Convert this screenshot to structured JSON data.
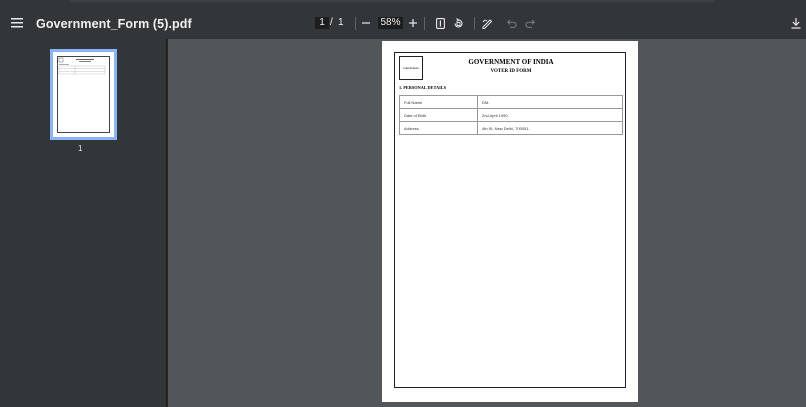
{
  "toolbar": {
    "title": "Government_Form (5).pdf",
    "page_current": "1",
    "page_separator": "/",
    "page_total": "1",
    "zoom": "58%"
  },
  "sidebar": {
    "thumbnail_label": "1"
  },
  "document": {
    "photo_label": "Candidate",
    "title": "GOVERNMENT OF INDIA",
    "subtitle": "VOTER ID FORM",
    "section_title": "1. PERSONAL DETAILS",
    "rows": [
      {
        "label": "Full Name",
        "value": "DM."
      },
      {
        "label": "Date of Birth",
        "value": "2nd April 1990."
      },
      {
        "label": "Address",
        "value": "4th St. New Delhi, 700051."
      }
    ]
  },
  "colors": {
    "toolbar_bg": "#323639",
    "viewer_bg": "#525659",
    "thumb_highlight": "#8ab4f8"
  }
}
